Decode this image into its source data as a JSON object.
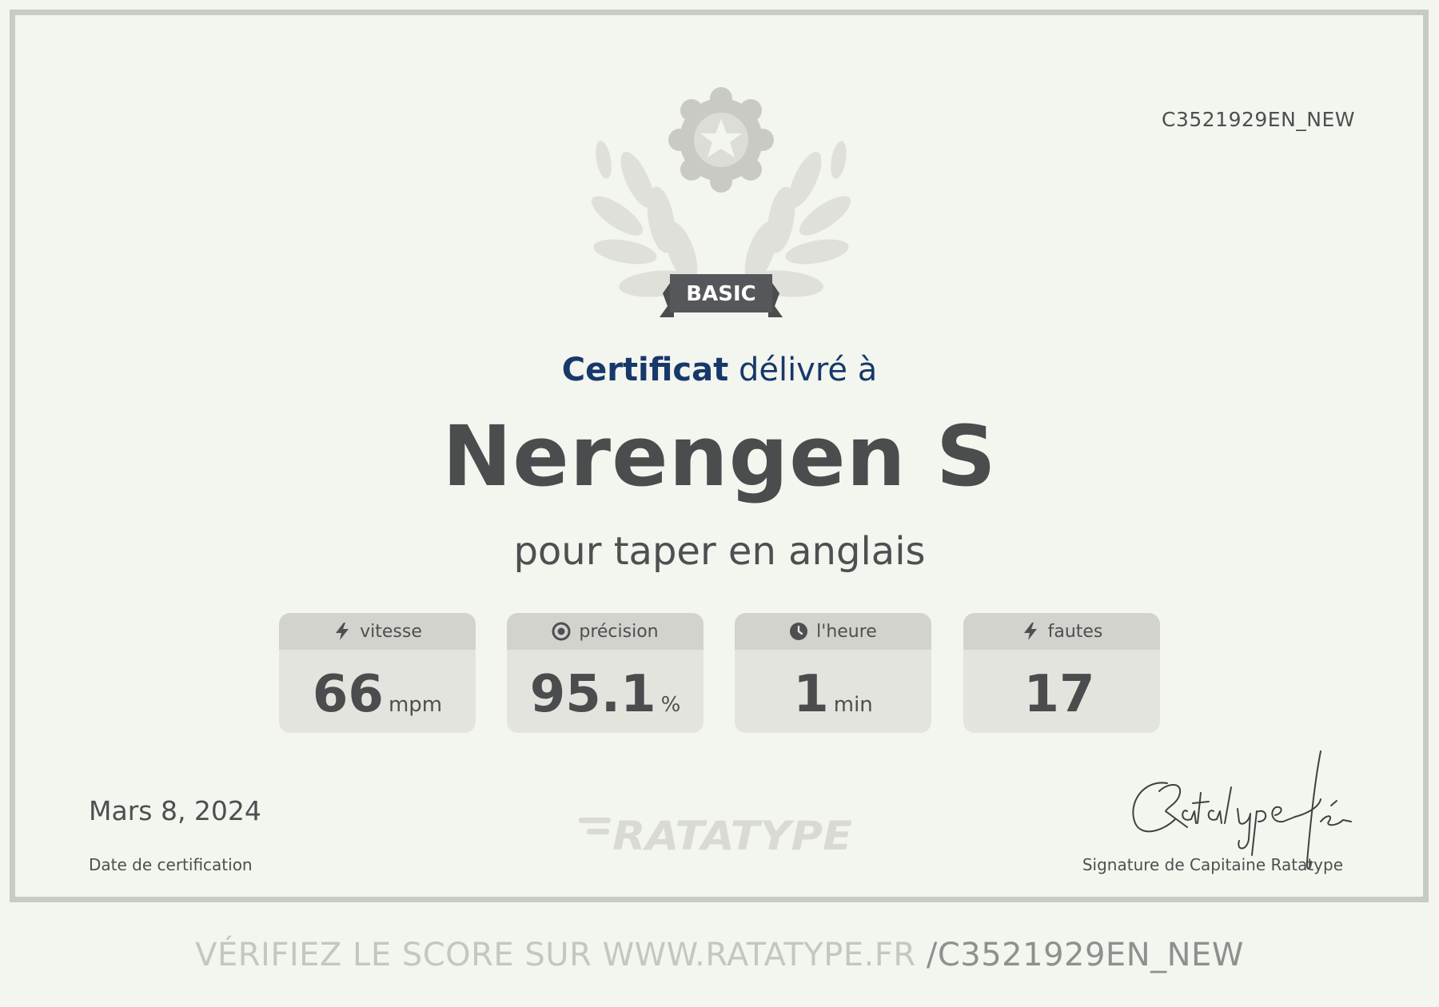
{
  "certificate": {
    "id": "C3521929EN_NEW",
    "badge_label": "BASIC",
    "title_strong": "Certificat",
    "title_rest": "délivré à",
    "recipient": "Nerengen S",
    "subtitle": "pour taper en anglais"
  },
  "stats": [
    {
      "icon": "lightning-icon",
      "label": "vitesse",
      "value": "66",
      "unit": "mpm"
    },
    {
      "icon": "target-icon",
      "label": "précision",
      "value": "95.1",
      "unit": "%"
    },
    {
      "icon": "clock-icon",
      "label": "l'heure",
      "value": "1",
      "unit": "min"
    },
    {
      "icon": "lightning-icon",
      "label": "fautes",
      "value": "17",
      "unit": ""
    }
  ],
  "footer": {
    "date": "Mars 8, 2024",
    "date_caption": "Date de certification",
    "logo_text": "RATATYPE",
    "signature_caption": "Signature de Capitaine Ratatype"
  },
  "verify": {
    "prefix": "VÉRIFIEZ LE SCORE SUR WWW.RATATYPE.FR ",
    "code": "/C3521929EN_NEW"
  },
  "colors": {
    "background": "#f3f5ef",
    "frame": "#c8cac4",
    "title": "#17386a",
    "text": "#4d4f50",
    "card": "#e3e4de",
    "card_head": "#d2d3cd"
  }
}
